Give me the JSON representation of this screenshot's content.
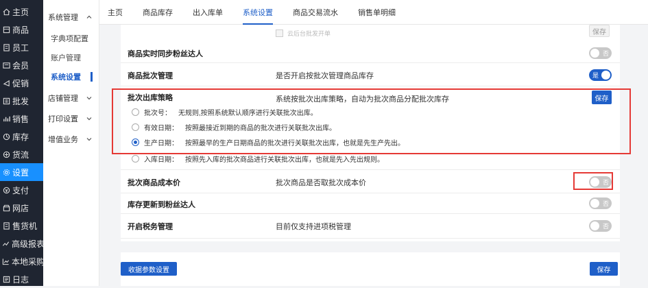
{
  "left_nav": [
    {
      "icon": "home-icon",
      "label": "主页"
    },
    {
      "icon": "goods-icon",
      "label": "商品"
    },
    {
      "icon": "staff-icon",
      "label": "员工"
    },
    {
      "icon": "member-icon",
      "label": "会员"
    },
    {
      "icon": "promotion-icon",
      "label": "促销"
    },
    {
      "icon": "wholesale-icon",
      "label": "批发"
    },
    {
      "icon": "sales-icon",
      "label": "销售"
    },
    {
      "icon": "inventory-icon",
      "label": "库存"
    },
    {
      "icon": "supply-icon",
      "label": "货流"
    },
    {
      "icon": "settings-icon",
      "label": "设置"
    },
    {
      "icon": "payment-icon",
      "label": "支付"
    },
    {
      "icon": "store-icon",
      "label": "网店"
    },
    {
      "icon": "vending-icon",
      "label": "售货机"
    },
    {
      "icon": "report-icon",
      "label": "高级报表"
    },
    {
      "icon": "local-purchase-icon",
      "label": "本地采购"
    },
    {
      "icon": "log-icon",
      "label": "日志"
    }
  ],
  "sub_nav": {
    "system_mgmt": "系统管理",
    "items": [
      "字典项配置",
      "账户管理",
      "系统设置"
    ],
    "store_mgmt": "店铺管理",
    "print_settings": "打印设置",
    "value_added": "增值业务"
  },
  "tabs": [
    "主页",
    "商品库存",
    "出入库单",
    "系统设置",
    "商品交易流水",
    "销售单明细"
  ],
  "settings": {
    "cloud_wholesale": "云后台批发开单",
    "save_label": "保存",
    "realtime_sync": {
      "label": "商品实时同步粉丝达人",
      "toggle": "否"
    },
    "batch_mgmt": {
      "label": "商品批次管理",
      "desc": "是否开启按批次管理商品库存",
      "toggle": "是"
    },
    "batch_strategy": {
      "label": "批次出库策略",
      "desc": "系统按批次出库策略，自动为批次商品分配批次库存",
      "options": [
        {
          "name": "批次号：",
          "desc": "无规则,按照系统默认顺序进行关联批次出库。"
        },
        {
          "name": "有效日期：",
          "desc": "按照最接近到期的商品的批次进行关联批次出库。"
        },
        {
          "name": "生产日期：",
          "desc": "按照最早的生产日期商品的批次进行关联批次出库，也就是先生产先出。"
        },
        {
          "name": "入库日期：",
          "desc": "按照先入库的批次商品进行关联批次出库，也就是先入先出规则。"
        }
      ],
      "selected": "生产日期："
    },
    "batch_cost": {
      "label": "批次商品成本价",
      "desc": "批次商品是否取批次成本价",
      "toggle": "否"
    },
    "stock_sync": {
      "label": "库存更新到粉丝达人",
      "toggle": "否"
    },
    "tax_mgmt": {
      "label": "开启税务管理",
      "desc": "目前仅支持进项税管理",
      "toggle": "否"
    }
  },
  "bottom": {
    "receipt_params": "收据参数设置",
    "save_label": "保存"
  },
  "colors": {
    "primary": "#1f5fc8",
    "sidebar": "#1f2531",
    "active_nav": "#1890ff",
    "highlight": "#e53935"
  }
}
